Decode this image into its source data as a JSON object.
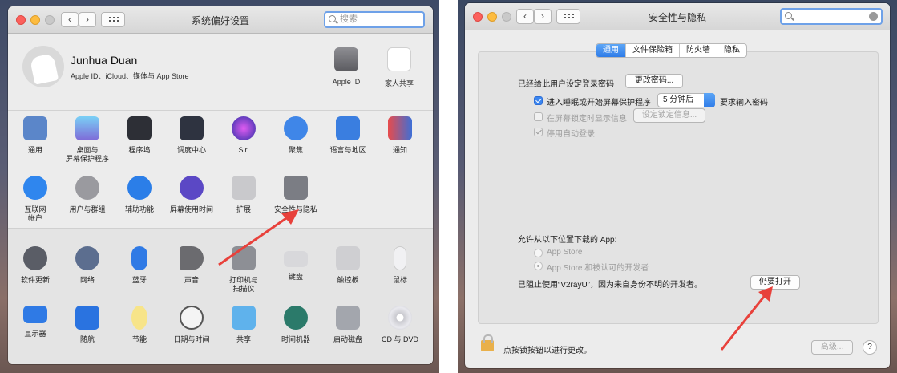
{
  "left_window": {
    "title": "系统偏好设置",
    "search_placeholder": "搜索",
    "user": {
      "name": "Junhua Duan",
      "subtitle": "Apple ID、iCloud、媒体与 App Store"
    },
    "user_icons": [
      {
        "label": "Apple ID",
        "icon": "apple-id-icon"
      },
      {
        "label": "家人共享",
        "icon": "family-sharing-icon"
      }
    ],
    "row1": [
      {
        "label": "通用",
        "icon": "general-icon"
      },
      {
        "label": "桌面与\n屏幕保护程序",
        "icon": "desktop-screensaver-icon"
      },
      {
        "label": "程序坞",
        "icon": "dock-icon"
      },
      {
        "label": "调度中心",
        "icon": "mission-control-icon"
      },
      {
        "label": "Siri",
        "icon": "siri-icon"
      },
      {
        "label": "聚焦",
        "icon": "spotlight-icon"
      },
      {
        "label": "语言与地区",
        "icon": "language-region-icon"
      },
      {
        "label": "通知",
        "icon": "notifications-icon"
      }
    ],
    "row2": [
      {
        "label": "互联网\n帐户",
        "icon": "internet-accounts-icon"
      },
      {
        "label": "用户与群组",
        "icon": "users-groups-icon"
      },
      {
        "label": "辅助功能",
        "icon": "accessibility-icon"
      },
      {
        "label": "屏幕使用时间",
        "icon": "screen-time-icon"
      },
      {
        "label": "扩展",
        "icon": "extensions-icon"
      },
      {
        "label": "安全性与隐私",
        "icon": "security-privacy-icon"
      }
    ],
    "row3": [
      {
        "label": "软件更新",
        "icon": "software-update-icon"
      },
      {
        "label": "网络",
        "icon": "network-icon"
      },
      {
        "label": "蓝牙",
        "icon": "bluetooth-icon"
      },
      {
        "label": "声音",
        "icon": "sound-icon"
      },
      {
        "label": "打印机与\n扫描仪",
        "icon": "printers-scanners-icon"
      },
      {
        "label": "键盘",
        "icon": "keyboard-icon"
      },
      {
        "label": "触控板",
        "icon": "trackpad-icon"
      },
      {
        "label": "鼠标",
        "icon": "mouse-icon"
      }
    ],
    "row4": [
      {
        "label": "显示器",
        "icon": "displays-icon"
      },
      {
        "label": "随航",
        "icon": "sidecar-icon"
      },
      {
        "label": "节能",
        "icon": "energy-saver-icon"
      },
      {
        "label": "日期与时间",
        "icon": "date-time-icon"
      },
      {
        "label": "共享",
        "icon": "sharing-icon"
      },
      {
        "label": "时间机器",
        "icon": "time-machine-icon"
      },
      {
        "label": "启动磁盘",
        "icon": "startup-disk-icon"
      },
      {
        "label": "CD 与 DVD",
        "icon": "cd-dvd-icon"
      }
    ]
  },
  "right_window": {
    "title": "安全性与隐私",
    "tabs": [
      "通用",
      "文件保险箱",
      "防火墙",
      "隐私"
    ],
    "active_tab": "通用",
    "password_set_label": "已经给此用户设定登录密码",
    "change_password_button": "更改密码...",
    "require_password_prefix": "进入睡眠或开始屏幕保护程序",
    "require_password_delay": "5 分钟后",
    "require_password_suffix": "要求输入密码",
    "show_message_label": "在屏幕锁定时显示信息",
    "set_lock_message_button": "设定锁定信息...",
    "disable_auto_login_label": "停用自动登录",
    "allow_apps_label": "允许从以下位置下载的 App:",
    "option_app_store": "App Store",
    "option_app_store_dev": "App Store 和被认可的开发者",
    "blocked_message": "已阻止使用“V2rayU”，因为来自身份不明的开发者。",
    "open_anyway_button": "仍要打开",
    "lock_message": "点按锁按钮以进行更改。",
    "advanced_button": "高级...",
    "help_button": "?"
  },
  "colors": {
    "accent": "#3b86f0",
    "arrow": "#e8413b"
  }
}
